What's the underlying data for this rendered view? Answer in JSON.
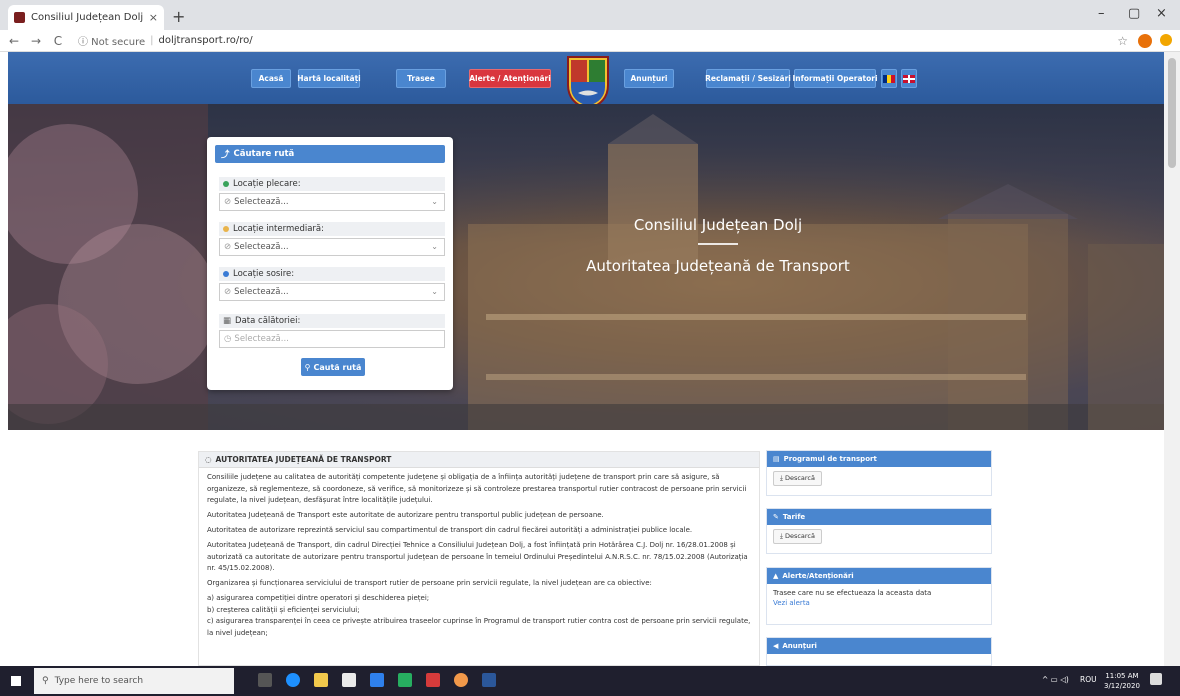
{
  "browser": {
    "tab_title": "Consiliul Județean Dolj - Autorita",
    "tab_close": "×",
    "new_tab": "+",
    "nav_back": "←",
    "nav_forward": "→",
    "nav_reload": "C",
    "not_secure": "ⓘ Not secure",
    "url": "doljtransport.ro/ro/",
    "win_min": "–",
    "win_max": "▢",
    "win_close": "×",
    "star": "☆"
  },
  "header": {
    "nav": [
      "Acasă",
      "Hartă localități",
      "Trasee",
      "Alerte / Atenționări",
      "Anunțuri",
      "Reclamații / Sesizări",
      "Informații Operatori"
    ]
  },
  "hero": {
    "title": "Consiliul Județean Dolj",
    "subtitle": "Autoritatea Județeană de Transport"
  },
  "search": {
    "header": "Căutare rută",
    "departure_label": "Locație plecare:",
    "departure_value": "Selectează...",
    "intermediate_label": "Locație intermediară:",
    "intermediate_value": "Selectează...",
    "arrival_label": "Locație sosire:",
    "arrival_value": "Selectează...",
    "date_label": "Data călătoriei:",
    "date_placeholder": "Selectează...",
    "search_button": "Caută rută"
  },
  "main": {
    "heading": "AUTORITATEA JUDEȚEANĂ DE TRANSPORT",
    "p1": "Consiliile județene au calitatea de autorități competente județene și obligația de a înființa autorități județene de transport prin care să asigure, să organizeze, să reglementeze, să coordoneze, să verifice, să monitorizeze și să controleze prestarea transportul rutier contracost de persoane prin servicii regulate, la nivel județean, desfășurat între localitățile județului.",
    "p2": "Autoritatea Județeană de Transport este autoritate de autorizare pentru transportul public județean de persoane.",
    "p3": "Autoritatea de autorizare reprezintă serviciul sau compartimentul de transport din cadrul fiecărei autorități a administrației publice locale.",
    "p4": "Autoritatea Județeană de Transport, din cadrul Direcției Tehnice a Consiliului Județean Dolj, a fost înființată prin Hotărârea C.J. Dolj nr. 16/28.01.2008 și autorizată ca autoritate de autorizare pentru transportul județean de persoane în temeiul Ordinului Președintelui A.N.R.S.C. nr. 78/15.02.2008 (Autorizația nr. 45/15.02.2008).",
    "p5": "Organizarea și funcționarea serviciului de transport rutier de persoane prin servicii regulate, la nivel județean are ca obiective:",
    "li_a": "a) asigurarea competiției dintre operatori și deschiderea pieței;",
    "li_b": "b) creșterea calității și eficienței serviciului;",
    "li_c": "c) asigurarea transparenței în ceea ce privește atribuirea traseelor cuprinse în Programul de transport rutier contra cost de persoane prin servicii regulate, la nivel județean;"
  },
  "sidebar": {
    "program_title": "Programul de transport",
    "program_btn": "Descarcă",
    "tarife_title": "Tarife",
    "tarife_btn": "Descarcă",
    "alerts_title": "Alerte/Atenționări",
    "alerts_text": "Trasee care nu se efectueaza la aceasta data",
    "alerts_link": "Vezi alerta",
    "anunturi_title": "Anunțuri"
  },
  "taskbar": {
    "search_placeholder": "Type here to search",
    "lang": "ROU",
    "time": "11:05 AM",
    "date": "3/12/2020"
  },
  "colors": {
    "header_blue": "#3c6cb0",
    "button_blue": "#4a86cf",
    "alert_red": "#d9363e"
  }
}
